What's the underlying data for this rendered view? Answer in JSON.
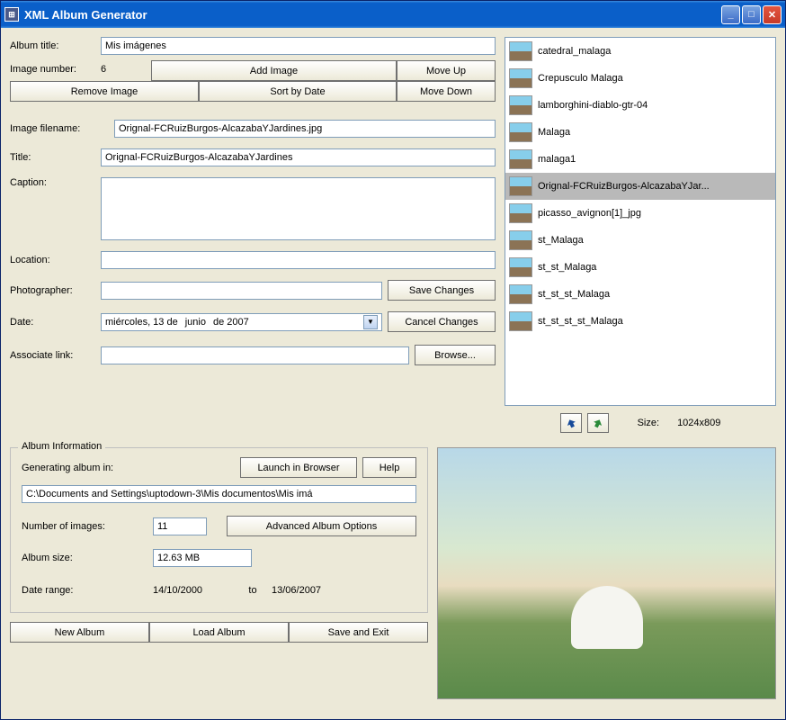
{
  "window": {
    "title": "XML Album Generator"
  },
  "album": {
    "title_label": "Album title:",
    "title_value": "Mis imágenes",
    "image_number_label": "Image number:",
    "image_number_value": "6"
  },
  "buttons": {
    "add_image": "Add Image",
    "move_up": "Move Up",
    "remove_image": "Remove Image",
    "sort_by_date": "Sort by Date",
    "move_down": "Move Down",
    "save_changes": "Save Changes",
    "cancel_changes": "Cancel Changes",
    "browse": "Browse...",
    "launch_browser": "Launch in Browser",
    "help": "Help",
    "advanced": "Advanced Album Options",
    "new_album": "New Album",
    "load_album": "Load Album",
    "save_exit": "Save and Exit"
  },
  "fields": {
    "filename_label": "Image filename:",
    "filename_value": "Orignal-FCRuizBurgos-AlcazabaYJardines.jpg",
    "title_label": "Title:",
    "title_value": "Orignal-FCRuizBurgos-AlcazabaYJardines",
    "caption_label": "Caption:",
    "caption_value": "",
    "location_label": "Location:",
    "location_value": "",
    "photographer_label": "Photographer:",
    "photographer_value": "",
    "date_label": "Date:",
    "date_day": "miércoles, 13 de",
    "date_month": "junio",
    "date_year": "de 2007",
    "associate_label": "Associate link:",
    "associate_value": ""
  },
  "list": {
    "selected_index": 5,
    "items": [
      "catedral_malaga",
      "Crepusculo Malaga",
      "lamborghini-diablo-gtr-04",
      "Malaga",
      "malaga1",
      "Orignal-FCRuizBurgos-AlcazabaYJar...",
      "picasso_avignon[1]_jpg",
      "st_Malaga",
      "st_st_Malaga",
      "st_st_st_Malaga",
      "st_st_st_st_Malaga"
    ]
  },
  "size": {
    "label": "Size:",
    "value": "1024x809"
  },
  "info": {
    "group_title": "Album Information",
    "generating_label": "Generating album in:",
    "path_value": "C:\\Documents and Settings\\uptodown-3\\Mis documentos\\Mis imá",
    "num_images_label": "Number of images:",
    "num_images_value": "11",
    "album_size_label": "Album size:",
    "album_size_value": "12.63 MB",
    "date_range_label": "Date range:",
    "date_from": "14/10/2000",
    "date_to_label": "to",
    "date_to": "13/06/2007"
  }
}
